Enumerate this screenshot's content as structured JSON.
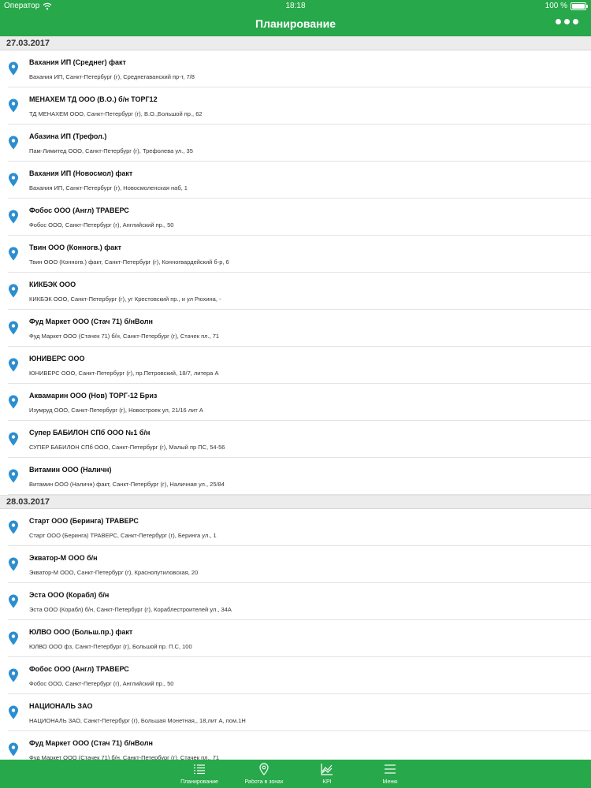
{
  "status_bar": {
    "carrier": "Оператор",
    "time": "18:18",
    "battery": "100 %"
  },
  "header": {
    "title": "Планирование"
  },
  "sections": [
    {
      "date": "27.03.2017",
      "items": [
        {
          "title": "Вахания ИП (Среднег) факт",
          "address": "Вахания ИП, Санкт-Петербург (г), Среднегаванский пр-т, 7/8"
        },
        {
          "title": "МЕНАХЕМ ТД ООО (В.О.) б/н ТОРГ12",
          "address": "ТД МЕНАХЕМ ООО, Санкт-Петербург (г), В.О.,Большой пр., 62"
        },
        {
          "title": "Абазина ИП (Трефол.)",
          "address": "Пам-Лимитед ООО, Санкт-Петербург (г), Трефолева ул., 35"
        },
        {
          "title": "Вахания ИП (Новосмол) факт",
          "address": "Вахания ИП, Санкт-Петербург (г), Новосмоленская наб, 1"
        },
        {
          "title": "Фобос ООО (Англ) ТРАВЕРС",
          "address": "Фобос ООО, Санкт-Петербург (г), Английский пр., 50"
        },
        {
          "title": "Твин ООО (Конногв.) факт",
          "address": "Твин ООО (Конногв.) факт, Санкт-Петербург (г), Конногвардейский б-р, 6"
        },
        {
          "title": "КИКБЭК ООО",
          "address": "КИКБЭК ООО, Санкт-Петербург (г), уг Крестовский пр., и ул Рюхина, -"
        },
        {
          "title": "Фуд Маркет ООО (Стач 71) б/нВолн",
          "address": "Фуд Маркет ООО (Стачек 71) б/н, Санкт-Петербург (г), Стачек пл., 71"
        },
        {
          "title": "ЮНИВЕРС ООО",
          "address": "ЮНИВЕРС ООО, Санкт-Петербург (г), пр.Петровский, 18/7, литера А"
        },
        {
          "title": "Аквамарин ООО (Нов) ТОРГ-12 Бриз",
          "address": "Изумруд ООО, Санкт-Петербург (г), Новостроек ул, 21/16 лит А"
        },
        {
          "title": "Супер БАБИЛОН СПб ООО №1 б/н",
          "address": "СУПЕР БАБИЛОН СПб ООО, Санкт-Петербург (г), Малый пр ПС, 54-56"
        },
        {
          "title": "Витамин ООО (Наличн)",
          "address": "Витамин ООО (Наличн) факт, Санкт-Петербург (г), Наличная ул., 25/84"
        }
      ]
    },
    {
      "date": "28.03.2017",
      "items": [
        {
          "title": "Старт ООО (Беринга) ТРАВЕРС",
          "address": "Старт ООО (Беринга) ТРАВЕРС, Санкт-Петербург (г), Беринга ул., 1"
        },
        {
          "title": "Экватор-М ООО б/н",
          "address": "Экватор-М ООО, Санкт-Петербург (г), Краснопутиловская, 20"
        },
        {
          "title": "Эста ООО (Корабл) б/н",
          "address": "Эста ООО (Корабл) б/н, Санкт-Петербург (г), Кораблестроителей ул., 34А"
        },
        {
          "title": "ЮЛВО ООО (Больш.пр.) факт",
          "address": "ЮЛВО ООО фз, Санкт-Петербург (г), Большой пр. П.С, 100"
        },
        {
          "title": "Фобос ООО (Англ) ТРАВЕРС",
          "address": "Фобос ООО, Санкт-Петербург (г), Английский пр., 50"
        },
        {
          "title": "НАЦИОНАЛЬ ЗАО",
          "address": "НАЦИОНАЛЬ ЗАО, Санкт-Петербург (г), Большая Монетная,, 18,лит А, пом.1Н"
        },
        {
          "title": "Фуд Маркет ООО (Стач 71) б/нВолн",
          "address": "Фуд Маркет ООО (Стачек 71) б/н, Санкт-Петербург (г), Стачек пл., 71"
        }
      ]
    }
  ],
  "tab_bar": {
    "tabs": [
      {
        "label": "Планирование",
        "icon": "list-icon"
      },
      {
        "label": "Работа в зонах",
        "icon": "map-pin-icon"
      },
      {
        "label": "KPI",
        "icon": "chart-icon"
      },
      {
        "label": "Меню",
        "icon": "menu-icon"
      }
    ]
  },
  "colors": {
    "accent": "#27a84a",
    "pin": "#2b8ed1",
    "section_bg": "#ececec"
  }
}
